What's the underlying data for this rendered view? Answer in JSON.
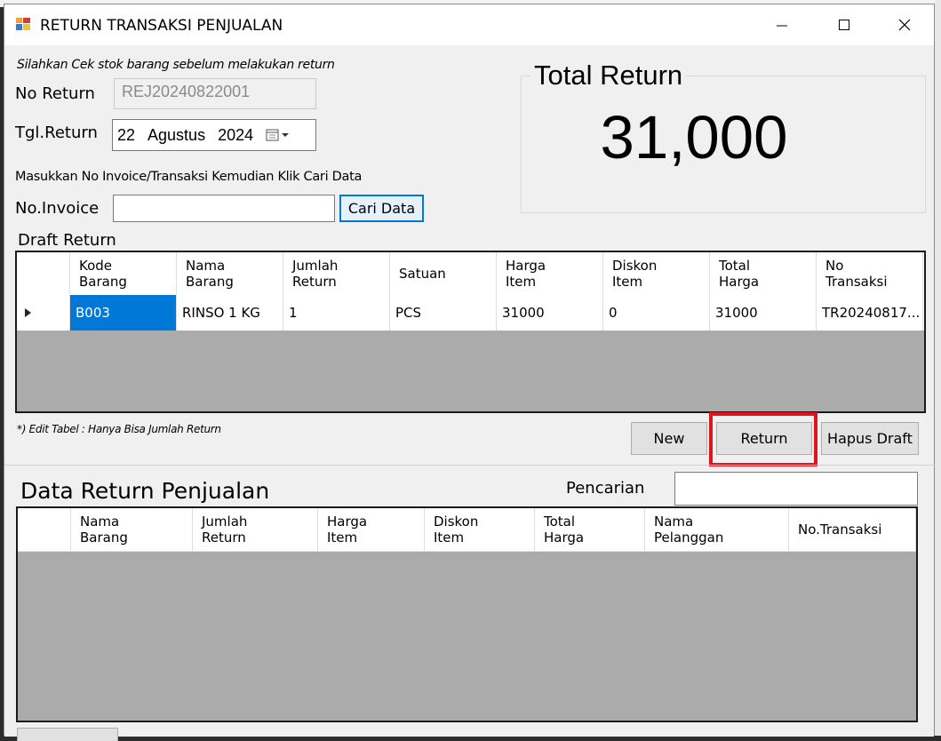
{
  "window": {
    "title": "RETURN TRANSAKSI PENJUALAN",
    "minimize_glyph": "—",
    "maximize_glyph": "☐",
    "close_glyph": "✕"
  },
  "form": {
    "hint": "Silahkan Cek stok barang sebelum melakukan return",
    "no_return_label": "No Return",
    "no_return_value": "REJ20240822001",
    "tgl_return_label": "Tgl.Return",
    "date_day": "22",
    "date_month": "Agustus",
    "date_year": "2024",
    "invoice_hint": "Masukkan No Invoice/Transaksi Kemudian Klik Cari Data",
    "invoice_label": "No.Invoice",
    "invoice_value": "",
    "cari_button": "Cari Data"
  },
  "total": {
    "label": "Total Return",
    "value": "31,000"
  },
  "draft": {
    "label": "Draft Return",
    "columns": [
      {
        "h1": "Kode",
        "h2": "Barang"
      },
      {
        "h1": "Nama",
        "h2": "Barang"
      },
      {
        "h1": "Jumlah",
        "h2": "Return"
      },
      {
        "h1": "Satuan",
        "h2": ""
      },
      {
        "h1": "Harga",
        "h2": "Item"
      },
      {
        "h1": "Diskon",
        "h2": "Item"
      },
      {
        "h1": "Total",
        "h2": "Harga"
      },
      {
        "h1": "No",
        "h2": "Transaksi"
      }
    ],
    "rows": [
      {
        "kode": "B003",
        "nama": "RINSO 1 KG",
        "jumlah": "1",
        "satuan": "PCS",
        "harga": "31000",
        "diskon": "0",
        "total": "31000",
        "no": "TR20240817..."
      }
    ],
    "note": "*) Edit Tabel : Hanya Bisa Jumlah Return",
    "btn_new": "New",
    "btn_return": "Return",
    "btn_hapus": "Hapus Draft"
  },
  "data": {
    "label": "Data Return Penjualan",
    "search_label": "Pencarian",
    "search_value": "",
    "columns": [
      {
        "h1": "Nama",
        "h2": "Barang"
      },
      {
        "h1": "Jumlah",
        "h2": "Return"
      },
      {
        "h1": "Harga",
        "h2": "Item"
      },
      {
        "h1": "Diskon",
        "h2": "Item"
      },
      {
        "h1": "Total",
        "h2": "Harga"
      },
      {
        "h1": "Nama",
        "h2": "Pelanggan"
      },
      {
        "h1": "No.Transaksi",
        "h2": ""
      }
    ]
  },
  "colors": {
    "highlight": "#e0141e",
    "selection": "#0078d7",
    "grid_empty": "#ababab"
  }
}
